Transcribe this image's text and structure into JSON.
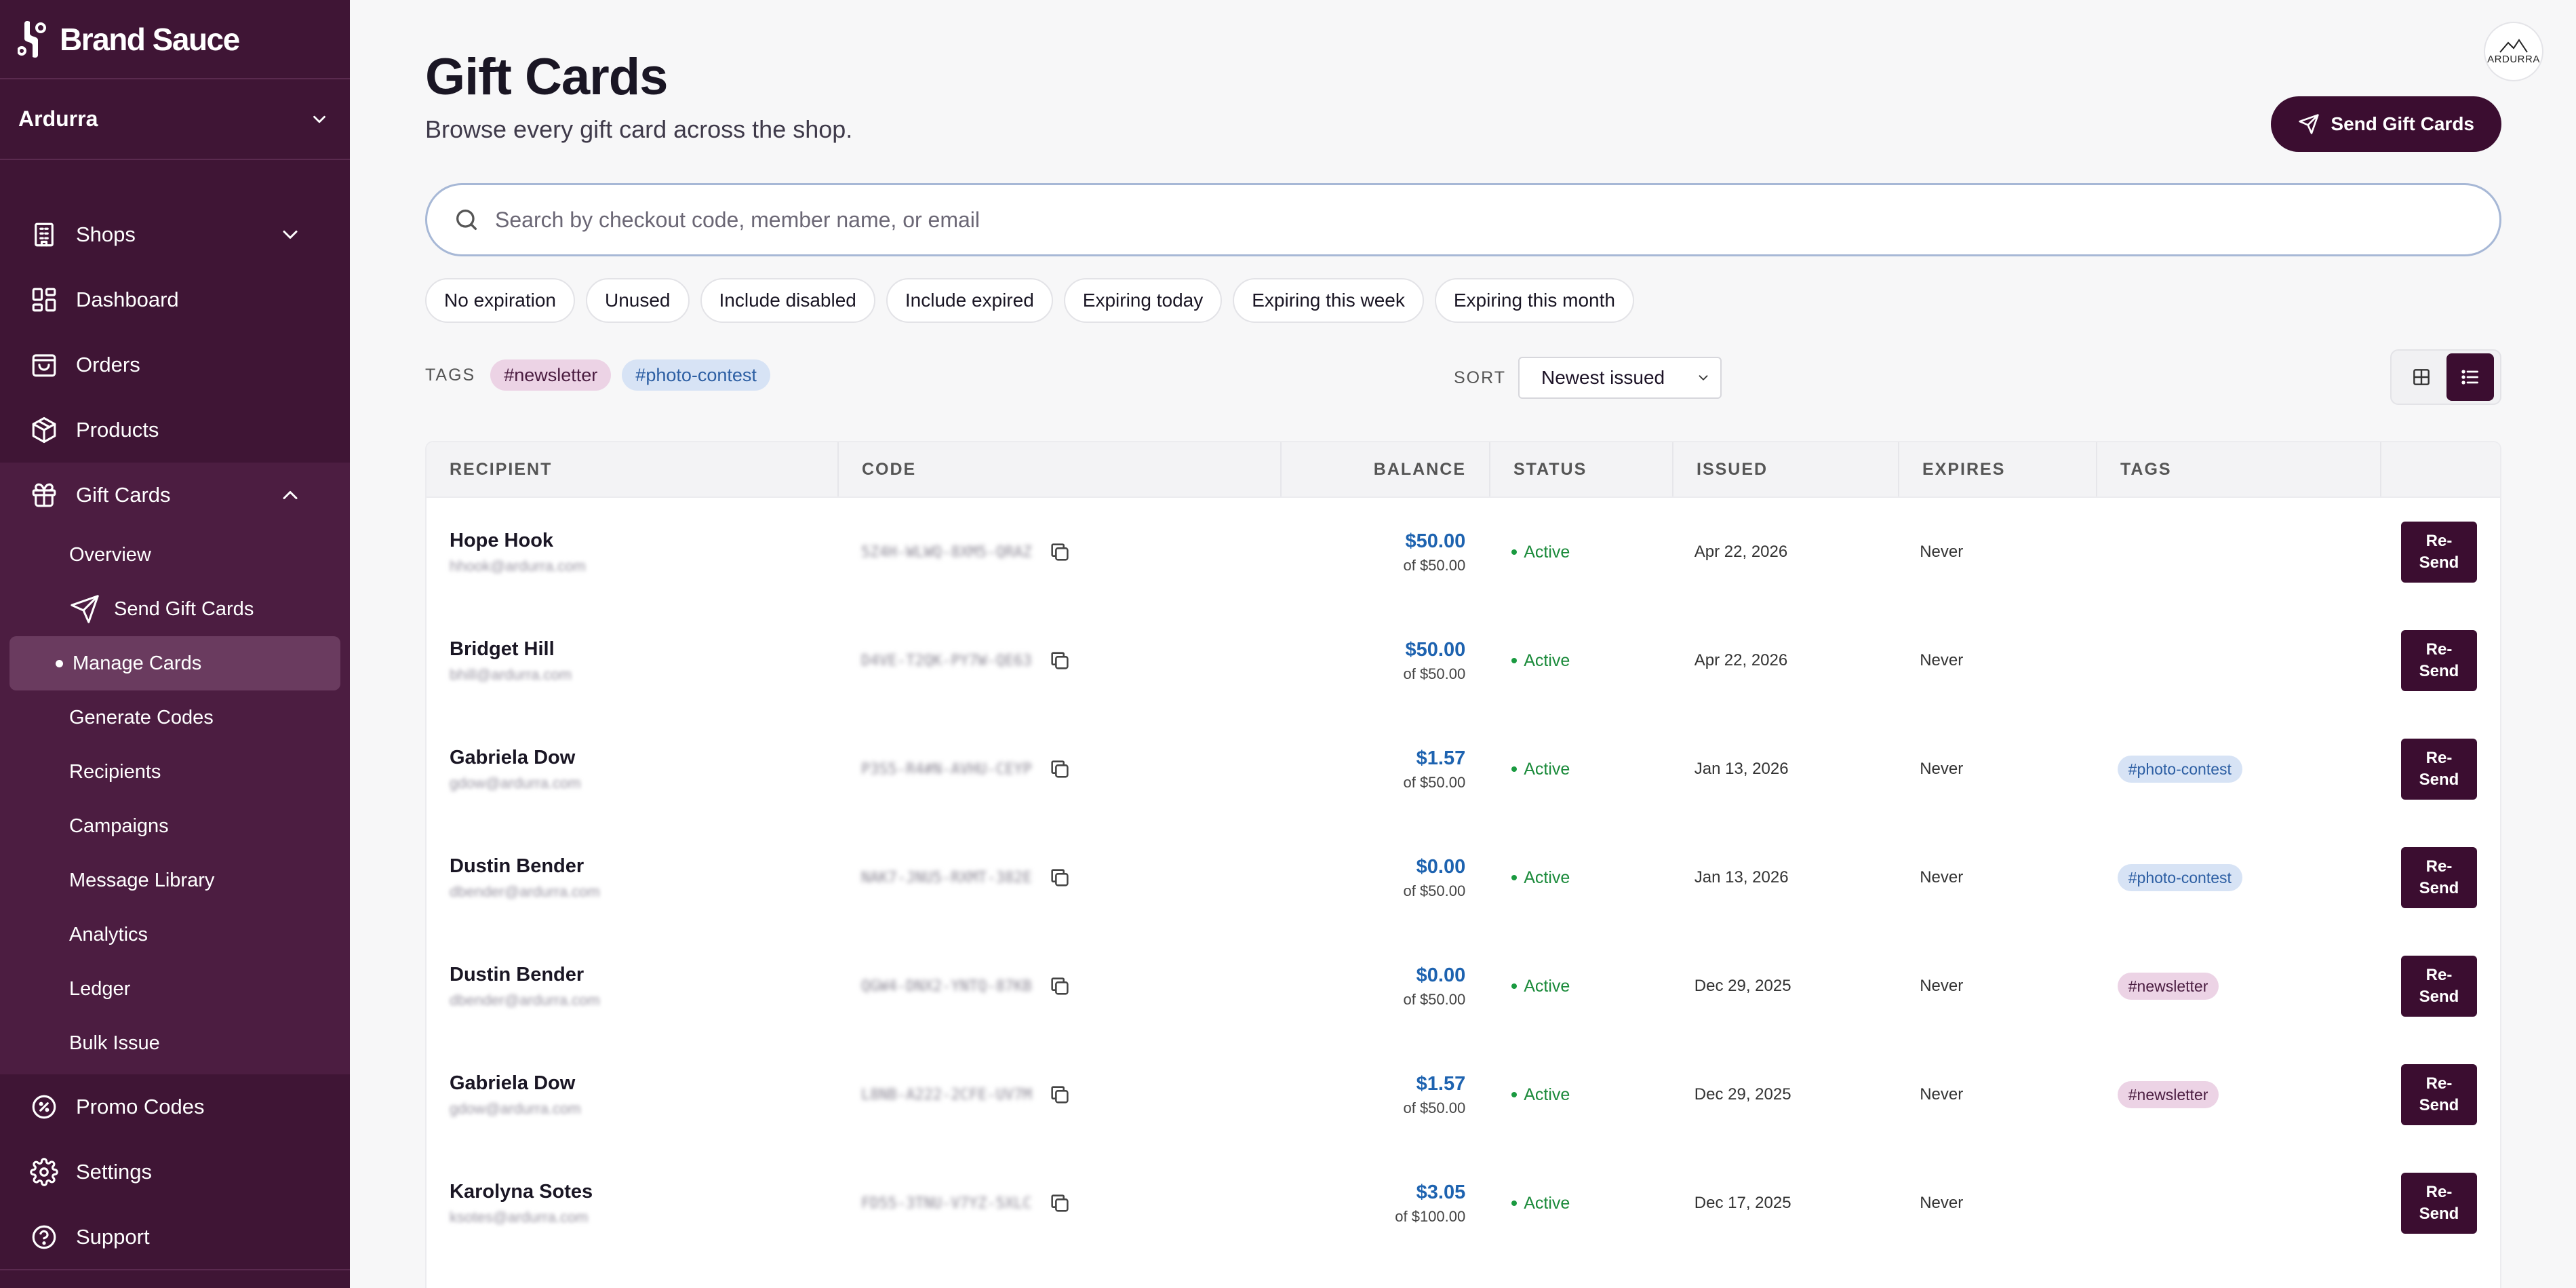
{
  "brand": {
    "name": "Brand Sauce"
  },
  "org": {
    "name": "Ardurra"
  },
  "avatar": {
    "text": "ARDURRA"
  },
  "nav": {
    "shops": "Shops",
    "dashboard": "Dashboard",
    "orders": "Orders",
    "products": "Products",
    "gift_cards": "Gift Cards",
    "promo_codes": "Promo Codes",
    "settings": "Settings",
    "support": "Support"
  },
  "subnav": {
    "overview": "Overview",
    "send_gift_cards": "Send Gift Cards",
    "manage_cards": "Manage Cards",
    "generate_codes": "Generate Codes",
    "recipients": "Recipients",
    "campaigns": "Campaigns",
    "message_library": "Message Library",
    "analytics": "Analytics",
    "ledger": "Ledger",
    "bulk_issue": "Bulk Issue"
  },
  "page": {
    "title": "Gift Cards",
    "subtitle": "Browse every gift card across the shop.",
    "send_button": "Send Gift Cards"
  },
  "search": {
    "placeholder": "Search by checkout code, member name, or email"
  },
  "filters": [
    "No expiration",
    "Unused",
    "Include disabled",
    "Include expired",
    "Expiring today",
    "Expiring this week",
    "Expiring this month"
  ],
  "tags": {
    "label": "TAGS",
    "items": [
      "#newsletter",
      "#photo-contest"
    ]
  },
  "sort": {
    "label": "SORT",
    "value": "Newest issued"
  },
  "table": {
    "headers": [
      "RECIPIENT",
      "CODE",
      "BALANCE",
      "STATUS",
      "ISSUED",
      "EXPIRES",
      "TAGS",
      ""
    ],
    "resend_label": "Re-Send",
    "rows": [
      {
        "name": "Hope Hook",
        "email": "hhook@ardurra.com",
        "code": "5Z4H-WLWQ-8XM5-QRAZ",
        "balance": "$50.00",
        "of": "of $50.00",
        "status": "Active",
        "issued": "Apr 22, 2026",
        "expires": "Never",
        "tag": "",
        "tag_type": ""
      },
      {
        "name": "Bridget Hill",
        "email": "bhill@ardurra.com",
        "code": "D4VE-T2QK-PY7W-QE63",
        "balance": "$50.00",
        "of": "of $50.00",
        "status": "Active",
        "issued": "Apr 22, 2026",
        "expires": "Never",
        "tag": "",
        "tag_type": ""
      },
      {
        "name": "Gabriela Dow",
        "email": "gdow@ardurra.com",
        "code": "P3S5-R4#N-AVHU-CEYP",
        "balance": "$1.57",
        "of": "of $50.00",
        "status": "Active",
        "issued": "Jan 13, 2026",
        "expires": "Never",
        "tag": "#photo-contest",
        "tag_type": "photo"
      },
      {
        "name": "Dustin Bender",
        "email": "dbender@ardurra.com",
        "code": "NAK7-JNU5-RXMT-382E",
        "balance": "$0.00",
        "of": "of $50.00",
        "status": "Active",
        "issued": "Jan 13, 2026",
        "expires": "Never",
        "tag": "#photo-contest",
        "tag_type": "photo"
      },
      {
        "name": "Dustin Bender",
        "email": "dbender@ardurra.com",
        "code": "QGW4-DNX2-YNTQ-87KB",
        "balance": "$0.00",
        "of": "of $50.00",
        "status": "Active",
        "issued": "Dec 29, 2025",
        "expires": "Never",
        "tag": "#newsletter",
        "tag_type": "newsletter"
      },
      {
        "name": "Gabriela Dow",
        "email": "gdow@ardurra.com",
        "code": "L8NB-A222-2CFE-UV7M",
        "balance": "$1.57",
        "of": "of $50.00",
        "status": "Active",
        "issued": "Dec 29, 2025",
        "expires": "Never",
        "tag": "#newsletter",
        "tag_type": "newsletter"
      },
      {
        "name": "Karolyna Sotes",
        "email": "ksotes@ardurra.com",
        "code": "FD55-3TNU-V7YZ-5XLC",
        "balance": "$3.05",
        "of": "of $100.00",
        "status": "Active",
        "issued": "Dec 17, 2025",
        "expires": "Never",
        "tag": "",
        "tag_type": ""
      }
    ]
  },
  "colors": {
    "sidebar": "#3f1535",
    "accent": "#3b0d30",
    "balance": "#1e63b0",
    "active": "#1a8a3a"
  }
}
